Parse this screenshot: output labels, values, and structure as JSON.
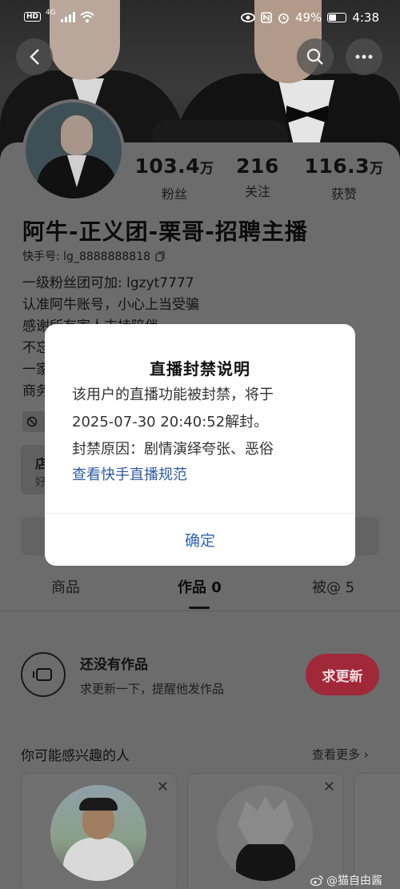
{
  "status_bar": {
    "hd": "HD",
    "net": "4G",
    "battery": "49%",
    "battery_level": 0.49,
    "time": "4:38"
  },
  "profile": {
    "fans_num": "103.4",
    "fans_unit": "万",
    "fans_label": "粉丝",
    "follow_num": "216",
    "follow_label": "关注",
    "likes_num": "116.3",
    "likes_unit": "万",
    "likes_label": "获赞",
    "name": "阿牛-正义团-栗哥-招聘主播",
    "kuaishou_id": "快手号: lg_8888888818",
    "bio": [
      "一级粉丝团可加: lgzyt7777",
      "认准阿牛账号，小心上当受骗",
      "感谢所有家人支持陪伴",
      "不忘",
      "一家",
      "商务"
    ],
    "tag_icon": "ban-icon",
    "shop_title": "店",
    "shop_sub": "好"
  },
  "tabs": {
    "goods": "商品",
    "works": "作品 0",
    "at": "被@ 5"
  },
  "empty": {
    "title": "还没有作品",
    "subtitle": "求更新一下，提醒他发作品",
    "button": "求更新"
  },
  "suggest": {
    "title": "你可能感兴趣的人",
    "see_more": "查看更多 ›",
    "close": "✕"
  },
  "dialog": {
    "title": "直播封禁说明",
    "line1": "该用户的直播功能被封禁，将于",
    "line2": "2025-07-30 20:40:52解封。",
    "line3": "封禁原因：剧情演绎夸张、恶俗",
    "link": "查看快手直播规范",
    "ok": "确定"
  },
  "watermark": "@猫自由酱",
  "colors": {
    "dim_overlay": "#6c6c6c",
    "request_button": "#a02839",
    "link_blue": "#2f5ca0",
    "confirm_blue": "#2f66b3"
  }
}
